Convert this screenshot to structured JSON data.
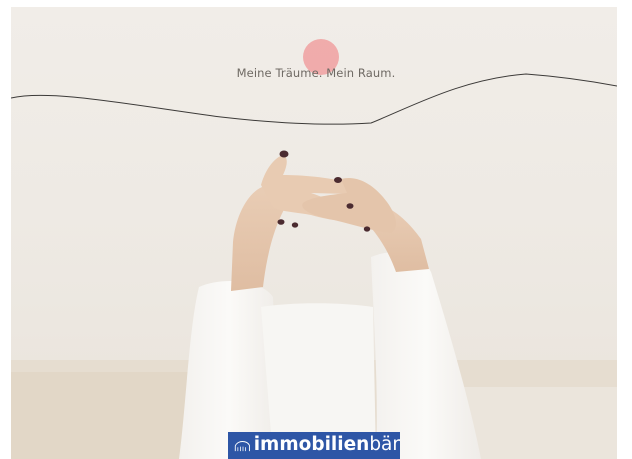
{
  "hero": {
    "tagline": "Meine Träume. Mein Raum."
  },
  "brand": {
    "name_bold": "immobilien",
    "name_light": "bär",
    "logo_color": "#2e56a6",
    "accent_dot_color": "#f0a0a0",
    "logo_icon": "bear-house-icon"
  }
}
